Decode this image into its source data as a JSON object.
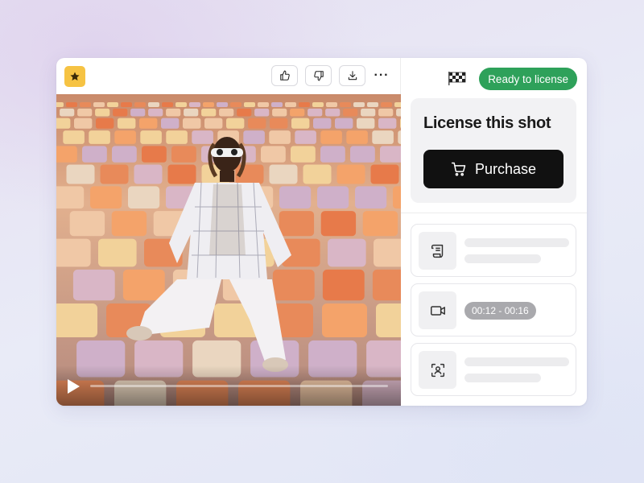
{
  "toolbar": {
    "favorite_icon": "star-icon",
    "like_icon": "thumbs-up-icon",
    "dislike_icon": "thumbs-down-icon",
    "download_icon": "download-icon",
    "more_label": "···"
  },
  "player": {
    "play_icon": "play-icon",
    "progress": 0
  },
  "panel": {
    "flag_icon": "checkered-flag-icon",
    "status_badge": "Ready to license",
    "status_color": "#2ea15a",
    "license_title": "License this shot",
    "purchase_label": "Purchase",
    "purchase_icon": "cart-icon",
    "items": [
      {
        "icon": "scroll-icon",
        "text": ""
      },
      {
        "icon": "video-camera-icon",
        "text": "00:12 - 00:16"
      },
      {
        "icon": "face-scan-icon",
        "text": ""
      }
    ]
  },
  "colors": {
    "accent_favorite": "#f6c343",
    "button_dark": "#111111"
  }
}
